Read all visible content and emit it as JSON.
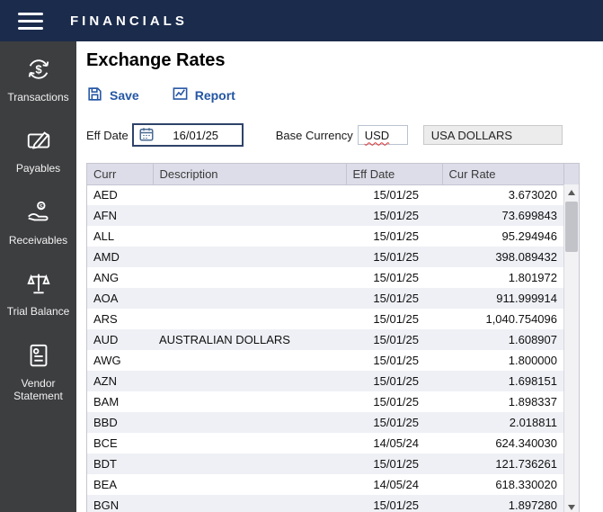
{
  "topbar": {
    "title": "FINANCIALS"
  },
  "sidebar": {
    "items": [
      {
        "label": "Transactions",
        "icon": "currency-sync-icon"
      },
      {
        "label": "Payables",
        "icon": "pen-document-icon"
      },
      {
        "label": "Receivables",
        "icon": "hand-coin-icon"
      },
      {
        "label": "Trial Balance",
        "icon": "balance-scale-icon"
      },
      {
        "label": "Vendor Statement",
        "icon": "statement-person-icon"
      }
    ]
  },
  "main": {
    "title": "Exchange Rates",
    "toolbar": {
      "save_label": "Save",
      "report_label": "Report"
    },
    "form": {
      "eff_date_label": "Eff Date",
      "eff_date_value": "16/01/25",
      "base_currency_label": "Base Currency",
      "base_currency_code": "USD",
      "base_currency_name": "USA DOLLARS"
    },
    "table": {
      "headers": [
        "Curr",
        "Description",
        "Eff Date",
        "Cur Rate"
      ],
      "rows": [
        [
          "AED",
          "",
          "15/01/25",
          "3.673020"
        ],
        [
          "AFN",
          "",
          "15/01/25",
          "73.699843"
        ],
        [
          "ALL",
          "",
          "15/01/25",
          "95.294946"
        ],
        [
          "AMD",
          "",
          "15/01/25",
          "398.089432"
        ],
        [
          "ANG",
          "",
          "15/01/25",
          "1.801972"
        ],
        [
          "AOA",
          "",
          "15/01/25",
          "911.999914"
        ],
        [
          "ARS",
          "",
          "15/01/25",
          "1,040.754096"
        ],
        [
          "AUD",
          "AUSTRALIAN DOLLARS",
          "15/01/25",
          "1.608907"
        ],
        [
          "AWG",
          "",
          "15/01/25",
          "1.800000"
        ],
        [
          "AZN",
          "",
          "15/01/25",
          "1.698151"
        ],
        [
          "BAM",
          "",
          "15/01/25",
          "1.898337"
        ],
        [
          "BBD",
          "",
          "15/01/25",
          "2.018811"
        ],
        [
          "BCE",
          "",
          "14/05/24",
          "624.340030"
        ],
        [
          "BDT",
          "",
          "15/01/25",
          "121.736261"
        ],
        [
          "BEA",
          "",
          "14/05/24",
          "618.330020"
        ],
        [
          "BGN",
          "",
          "15/01/25",
          "1.897280"
        ]
      ]
    }
  },
  "colors": {
    "topbar": "#1b2b4c",
    "sidebar": "#3d3e40",
    "accent": "#2456a4",
    "header_bg": "#dcdde8",
    "alt_row": "#eef0f5",
    "error_underline": "#e03030"
  }
}
